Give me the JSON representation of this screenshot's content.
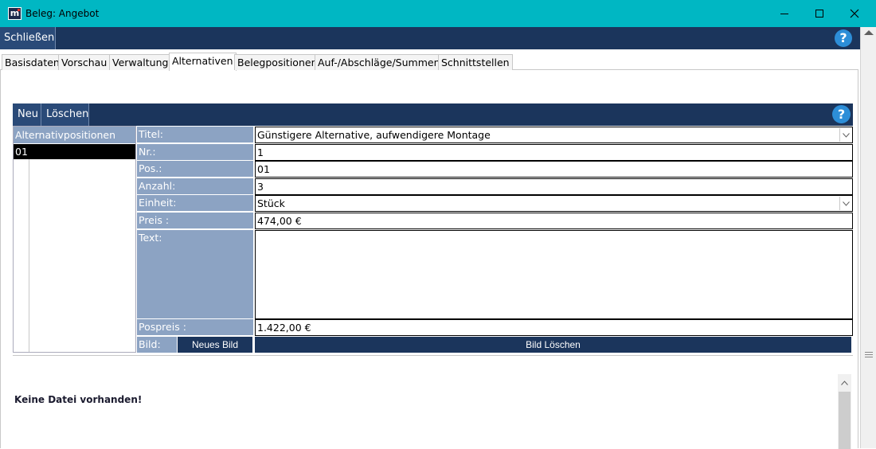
{
  "window": {
    "title": "Beleg: Angebot",
    "app_icon_letter": "m"
  },
  "toolbar": {
    "close_label": "Schließen",
    "help_label": "?"
  },
  "tabs": [
    {
      "label": "Basisdaten",
      "active": false
    },
    {
      "label": "Vorschau",
      "active": false
    },
    {
      "label": "Verwaltung",
      "active": false
    },
    {
      "label": "Alternativen",
      "active": true
    },
    {
      "label": "Belegpositionen",
      "active": false
    },
    {
      "label": "Auf-/Abschläge/Summen",
      "active": false
    },
    {
      "label": "Schnittstellen",
      "active": false
    }
  ],
  "inner_toolbar": {
    "new_label": "Neu",
    "delete_label": "Löschen",
    "help_label": "?"
  },
  "list": {
    "header": "Alternativpositionen",
    "items": [
      "01"
    ]
  },
  "form": {
    "title_label": "Titel:",
    "title_value": "Günstigere Alternative, aufwendigere Montage",
    "nr_label": "Nr.:",
    "nr_value": "1",
    "pos_label": "Pos.:",
    "pos_value": "01",
    "anzahl_label": "Anzahl:",
    "anzahl_value": "3",
    "einheit_label": "Einheit:",
    "einheit_value": "Stück",
    "preis_label": "Preis :",
    "preis_value": "474,00 €",
    "text_label": "Text:",
    "text_value": "",
    "pospreis_label": "Pospreis :",
    "pospreis_value": "1.422,00 €",
    "bild_label": "Bild:",
    "new_image_label": "Neues Bild",
    "delete_image_label": "Bild Löschen"
  },
  "image_area": {
    "message": "Keine Datei vorhanden!"
  },
  "colors": {
    "titlebar": "#00b7c3",
    "navy": "#1b355c",
    "label_bg": "#8ca3c3",
    "help": "#2d8ed8"
  }
}
